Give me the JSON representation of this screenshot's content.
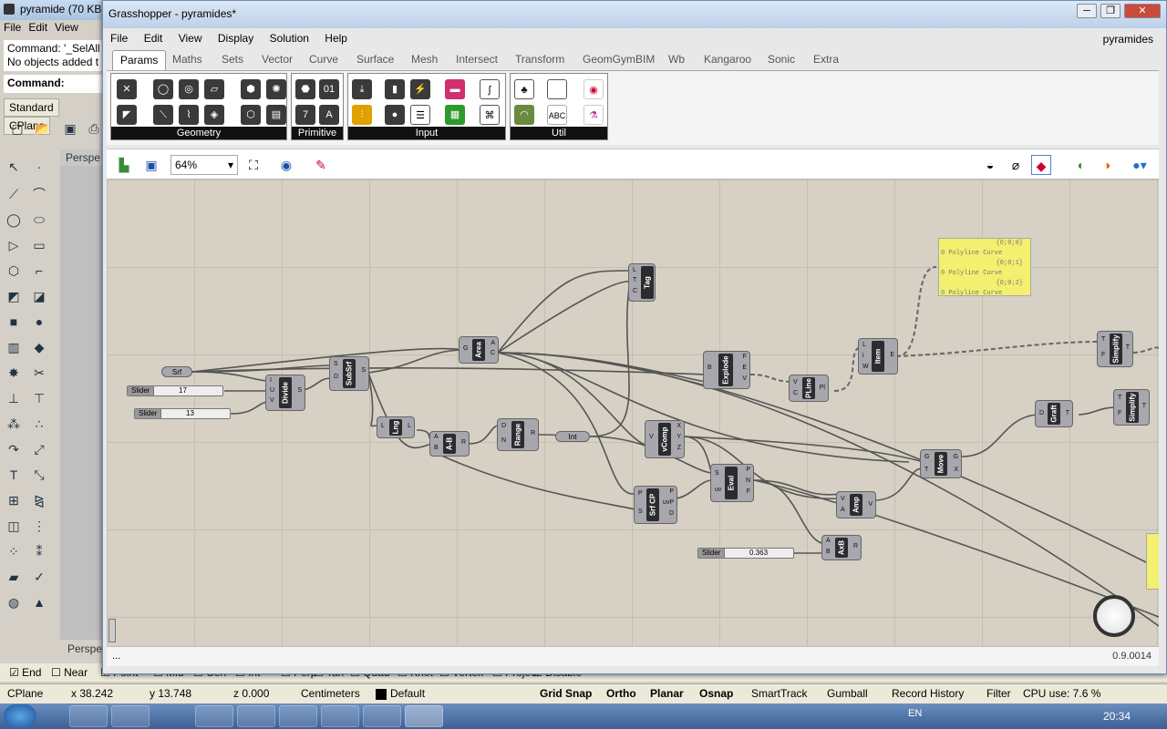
{
  "rhino": {
    "title": "pyramide (70 KB)",
    "menu": [
      "File",
      "Edit",
      "View"
    ],
    "command_history": [
      "Command: '_SelAll",
      "No objects added t"
    ],
    "command_prompt": "Command:",
    "toolbar_tabs": [
      "Standard",
      "CPlane"
    ],
    "viewport_label": "Perspe",
    "viewport_bottom_tab": "Perspe",
    "osnap": [
      "End",
      "Near",
      "Point",
      "Mid",
      "Cen",
      "Int",
      "Perp",
      "Tan",
      "Quad",
      "Knot",
      "Vertex",
      "Project",
      "Disable"
    ],
    "status": {
      "cplane": "CPlane",
      "x": "x 38.242",
      "y": "y 13.748",
      "z": "z 0.000",
      "units": "Centimeters",
      "layer": "Default",
      "buttons": [
        "Grid Snap",
        "Ortho",
        "Planar",
        "Osnap",
        "SmartTrack",
        "Gumball",
        "Record History",
        "Filter"
      ],
      "cpu": "CPU use: 7.6 %"
    }
  },
  "taskbar": {
    "lang": "EN",
    "clock": "20:34"
  },
  "gh": {
    "title": "Grasshopper - pyramides*",
    "menu": [
      "File",
      "Edit",
      "View",
      "Display",
      "Solution",
      "Help"
    ],
    "doc_name": "pyramides",
    "tabs": [
      "Params",
      "Maths",
      "Sets",
      "Vector",
      "Curve",
      "Surface",
      "Mesh",
      "Intersect",
      "Transform",
      "GeomGymBIM",
      "Wb",
      "Kangaroo",
      "Sonic",
      "Extra"
    ],
    "ribbon_groups": [
      "Geometry",
      "Primitive",
      "Input",
      "Util"
    ],
    "zoom": "64%",
    "version": "0.9.0014",
    "status_left": "...",
    "nodes": {
      "srf": "Srf",
      "slider1": {
        "label": "Slider",
        "value": "17"
      },
      "slider2": {
        "label": "Slider",
        "value": "13"
      },
      "slider3": {
        "label": "Slider",
        "value": "0.363"
      },
      "divide": "Divide",
      "subsrf": "SubSrf",
      "area": "Area",
      "tag": "Tag",
      "lng": "Lng",
      "ab": "A-B",
      "range": "Range",
      "int": "Int",
      "explode": "Explode",
      "pline": "PLine",
      "item": "Item",
      "vcomp": "vComp",
      "srfcp": "Srf CP",
      "eval": "Eval",
      "amp": "Amp",
      "axb": "AxB",
      "move": "Move",
      "graft": "Graft",
      "simplify1": "Simplify",
      "simplify2": "Simplify"
    },
    "panel_lines": [
      "{0;0;0}",
      "0 Polyline Curve",
      "{0;0;1}",
      "0 Polyline Curve",
      "{0;0;2}",
      "0 Polyline Curve"
    ]
  }
}
